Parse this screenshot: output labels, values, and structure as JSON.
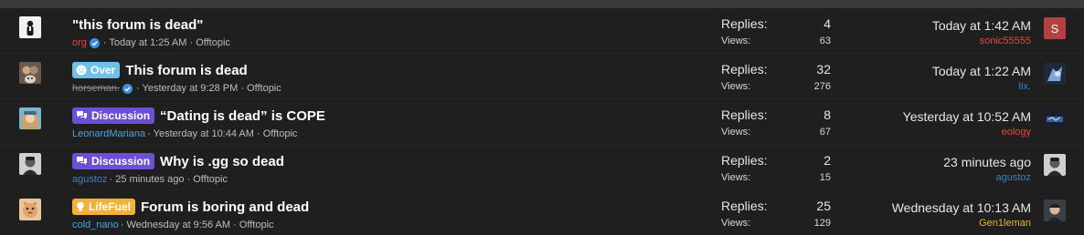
{
  "colors": {
    "over_prefix": "#6fc1e8",
    "discussion_prefix": "#6d4fd6",
    "lifefuel_prefix": "#f2b13a",
    "verified": "#3c8fe0",
    "user_red": "#e04b3f",
    "user_blue": "#3f7bd8",
    "user_lightblue": "#4aa3e0",
    "user_gold": "#e8b22c"
  },
  "labels": {
    "replies": "Replies:",
    "views": "Views:"
  },
  "threads": [
    {
      "title": "\"this forum is dead\"",
      "prefix": "",
      "author": "org",
      "author_color": "#e04b3f",
      "author_verified": true,
      "author_struck": false,
      "meta": "· Today at 1:25 AM · Offtopic",
      "replies": "4",
      "views": "63",
      "last_date": "Today at 1:42 AM",
      "last_user": "sonic55555",
      "last_user_color": "#e04b3f",
      "last_avatar_letter": "S"
    },
    {
      "title": "This forum is dead",
      "prefix": "Over",
      "prefix_icon": "frown-icon",
      "author": "horseman.",
      "author_color": "#8a8a8a",
      "author_verified": true,
      "author_struck": true,
      "meta": "· Yesterday at 9:28 PM · Offtopic",
      "replies": "32",
      "views": "276",
      "last_date": "Today at 1:22 AM",
      "last_user": "lix.",
      "last_user_color": "#3f7bd8",
      "last_avatar_letter": ""
    },
    {
      "title": "“Dating is dead” is COPE",
      "prefix": "Discussion",
      "prefix_icon": "chat-icon",
      "author": "LeonardMariana",
      "author_color": "#4aa3e0",
      "author_verified": false,
      "author_struck": false,
      "meta": "· Yesterday at 10:44 AM · Offtopic",
      "replies": "8",
      "views": "67",
      "last_date": "Yesterday at 10:52 AM",
      "last_user": "eology",
      "last_user_color": "#e04b3f",
      "last_avatar_letter": ""
    },
    {
      "title": "Why is .gg so dead",
      "prefix": "Discussion",
      "prefix_icon": "chat-icon",
      "author": "agustoz",
      "author_color": "#3f7bd8",
      "author_verified": false,
      "author_struck": false,
      "meta": "· 25 minutes ago · Offtopic",
      "replies": "2",
      "views": "15",
      "last_date": "23 minutes ago",
      "last_user": "agustoz",
      "last_user_color": "#3f7bd8",
      "last_avatar_letter": ""
    },
    {
      "title": "Forum is boring and dead",
      "prefix": "LifeFuel",
      "prefix_icon": "lightbulb-icon",
      "author": "cold_nano",
      "author_color": "#4aa3e0",
      "author_verified": false,
      "author_struck": false,
      "meta": "· Wednesday at 9:56 AM · Offtopic",
      "replies": "25",
      "views": "129",
      "last_date": "Wednesday at 10:13 AM",
      "last_user": "Gen1leman",
      "last_user_color": "#e8b22c",
      "last_avatar_letter": ""
    }
  ]
}
